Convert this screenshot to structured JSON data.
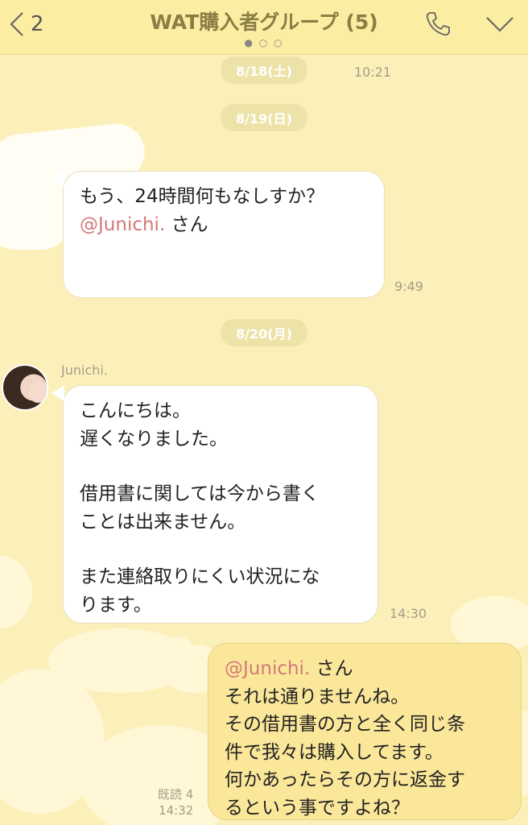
{
  "header": {
    "back_count": "2",
    "title": "WAT購入者グループ (5)",
    "page_dots": "● ○ ○"
  },
  "dates": {
    "d1": "8/18(土)",
    "d2": "8/19(日)",
    "d3": "8/20(月)"
  },
  "times": {
    "t0": "10:21",
    "t1": "9:49",
    "t2": "14:30",
    "t3": "14:32"
  },
  "msg1": {
    "line1": "もう、24時間何もなしすか？",
    "mention": "@Junichi.",
    "suffix": " さん"
  },
  "msg2": {
    "sender": "Junichi.",
    "lines": [
      "こんにちは。",
      "遅くなりました。",
      "",
      "借用書に関しては今から書く",
      "ことは出来ません。",
      "",
      "また連絡取りにくい状況にな",
      "ります。"
    ]
  },
  "msg3": {
    "mention": "@Junichi.",
    "suffix": " さん",
    "lines": [
      "それは通りませんね。",
      "その借用書の方と全く同じ条",
      "件で我々は購入してます。",
      "何かあったらその方に返金す",
      "るという事ですよね？"
    ]
  },
  "read_receipt": "既読 4",
  "colors": {
    "background": "#fcf0ba",
    "header": "#fbeea3",
    "my_bubble": "#fbe79a",
    "mention": "#d27a77"
  },
  "icons": {
    "back": "chevron-left-icon",
    "call": "phone-icon",
    "menu": "chevron-down-icon"
  }
}
